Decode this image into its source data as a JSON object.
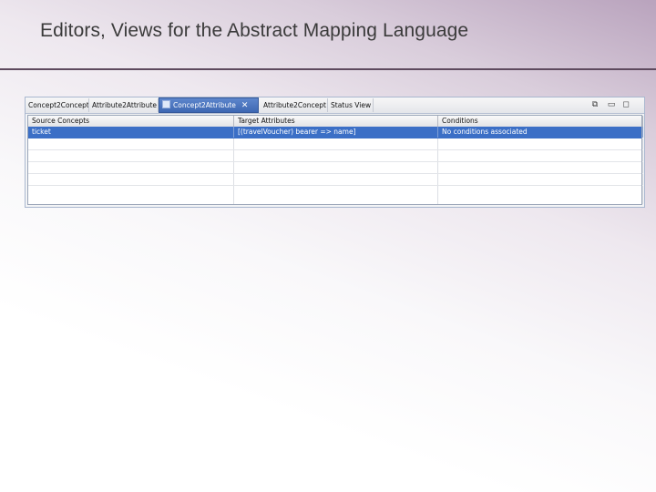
{
  "slide": {
    "title": "Editors, Views for the Abstract Mapping Language"
  },
  "editor": {
    "tabs": [
      {
        "label": "Concept2Concept"
      },
      {
        "label": "Attribute2Attribute"
      },
      {
        "label": "Concept2Attribute",
        "active": true
      },
      {
        "label": "Attribute2Concept"
      },
      {
        "label": "Status View"
      }
    ],
    "window_controls": {
      "restore_icon": "restore-icon",
      "minimize_icon": "minimize-icon",
      "maximize_icon": "maximize-icon"
    },
    "table": {
      "columns": [
        "Source Concepts",
        "Target Attributes",
        "Conditions"
      ],
      "rows": [
        [
          "ticket",
          "[(travelVoucher) bearer => name]",
          "No conditions associated"
        ]
      ],
      "empty_rows": 5
    },
    "colors": {
      "selection": "#3b6fc6",
      "active_tab": "#4a74bd",
      "title_rule": "#5e4a5e"
    }
  }
}
